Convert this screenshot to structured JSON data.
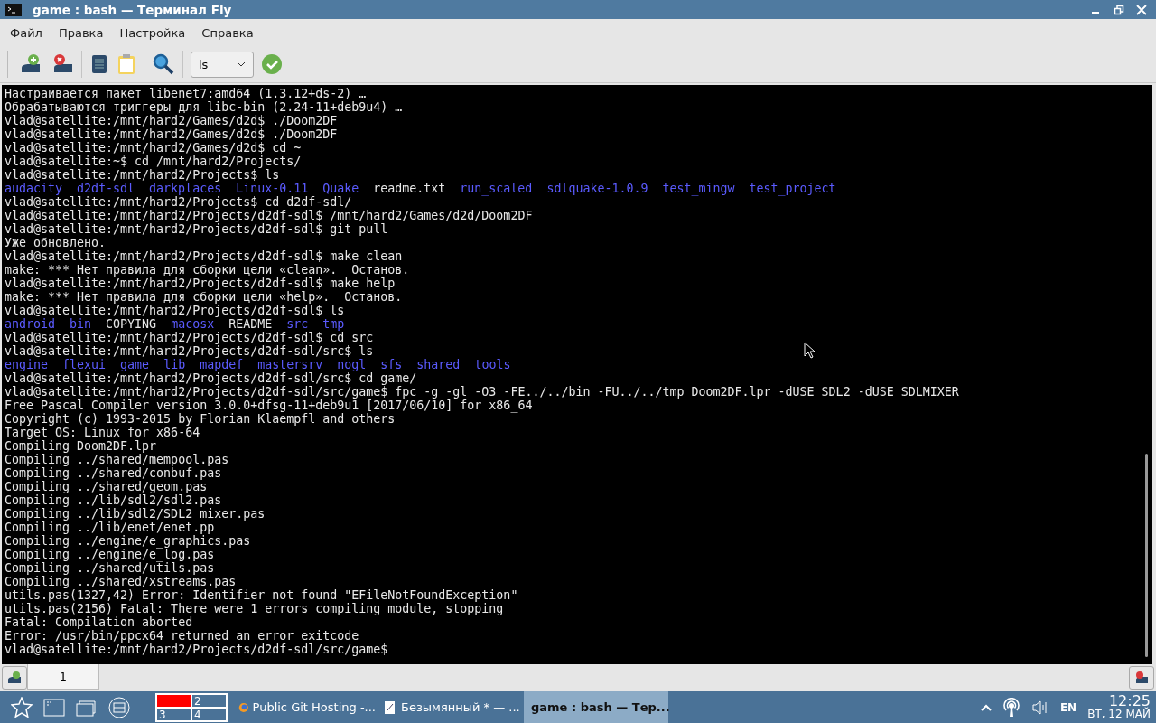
{
  "window": {
    "title": "game : bash — Терминал Fly"
  },
  "menu": [
    "Файл",
    "Правка",
    "Настройка",
    "Справка"
  ],
  "toolbar": {
    "command": {
      "value": "ls"
    }
  },
  "terminal": {
    "lines": [
      {
        "text": "Настраивается пакет libenet7:amd64 (1.3.12+ds-2) …"
      },
      {
        "text": "Обрабатываются триггеры для libc-bin (2.24-11+deb9u4) …"
      },
      {
        "text": "vlad@satellite:/mnt/hard2/Games/d2d$ ./Doom2DF"
      },
      {
        "text": "vlad@satellite:/mnt/hard2/Games/d2d$ ./Doom2DF"
      },
      {
        "text": "vlad@satellite:/mnt/hard2/Games/d2d$ cd ~"
      },
      {
        "text": "vlad@satellite:~$ cd /mnt/hard2/Projects/"
      },
      {
        "text": "vlad@satellite:/mnt/hard2/Projects$ ls"
      },
      {
        "items": [
          {
            "name": "audacity",
            "kind": "dir"
          },
          {
            "name": "d2df-sdl",
            "kind": "dir"
          },
          {
            "name": "darkplaces",
            "kind": "dir"
          },
          {
            "name": "Linux-0.11",
            "kind": "dir"
          },
          {
            "name": "Quake",
            "kind": "dir"
          },
          {
            "name": "readme.txt",
            "kind": "file"
          },
          {
            "name": "run_scaled",
            "kind": "dir"
          },
          {
            "name": "sdlquake-1.0.9",
            "kind": "dir"
          },
          {
            "name": "test_mingw",
            "kind": "dir"
          },
          {
            "name": "test_project",
            "kind": "dir"
          }
        ]
      },
      {
        "text": "vlad@satellite:/mnt/hard2/Projects$ cd d2df-sdl/"
      },
      {
        "text": "vlad@satellite:/mnt/hard2/Projects/d2df-sdl$ /mnt/hard2/Games/d2d/Doom2DF"
      },
      {
        "text": "vlad@satellite:/mnt/hard2/Projects/d2df-sdl$ git pull"
      },
      {
        "text": "Уже обновлено."
      },
      {
        "text": "vlad@satellite:/mnt/hard2/Projects/d2df-sdl$ make clean"
      },
      {
        "text": "make: *** Нет правила для сборки цели «clean».  Останов."
      },
      {
        "text": "vlad@satellite:/mnt/hard2/Projects/d2df-sdl$ make help"
      },
      {
        "text": "make: *** Нет правила для сборки цели «help».  Останов."
      },
      {
        "text": "vlad@satellite:/mnt/hard2/Projects/d2df-sdl$ ls"
      },
      {
        "items": [
          {
            "name": "android",
            "kind": "dir"
          },
          {
            "name": "bin",
            "kind": "dir"
          },
          {
            "name": "COPYING",
            "kind": "file"
          },
          {
            "name": "macosx",
            "kind": "dir"
          },
          {
            "name": "README",
            "kind": "file"
          },
          {
            "name": "src",
            "kind": "dir"
          },
          {
            "name": "tmp",
            "kind": "dir"
          }
        ]
      },
      {
        "text": "vlad@satellite:/mnt/hard2/Projects/d2df-sdl$ cd src"
      },
      {
        "text": "vlad@satellite:/mnt/hard2/Projects/d2df-sdl/src$ ls"
      },
      {
        "items": [
          {
            "name": "engine",
            "kind": "dir"
          },
          {
            "name": "flexui",
            "kind": "dir"
          },
          {
            "name": "game",
            "kind": "dir"
          },
          {
            "name": "lib",
            "kind": "dir"
          },
          {
            "name": "mapdef",
            "kind": "dir"
          },
          {
            "name": "mastersrv",
            "kind": "dir"
          },
          {
            "name": "nogl",
            "kind": "dir"
          },
          {
            "name": "sfs",
            "kind": "dir"
          },
          {
            "name": "shared",
            "kind": "dir"
          },
          {
            "name": "tools",
            "kind": "dir"
          }
        ]
      },
      {
        "text": "vlad@satellite:/mnt/hard2/Projects/d2df-sdl/src$ cd game/"
      },
      {
        "text": "vlad@satellite:/mnt/hard2/Projects/d2df-sdl/src/game$ fpc -g -gl -O3 -FE../../bin -FU../../tmp Doom2DF.lpr -dUSE_SDL2 -dUSE_SDLMIXER"
      },
      {
        "text": "Free Pascal Compiler version 3.0.0+dfsg-11+deb9u1 [2017/06/10] for x86_64"
      },
      {
        "text": "Copyright (c) 1993-2015 by Florian Klaempfl and others"
      },
      {
        "text": "Target OS: Linux for x86-64"
      },
      {
        "text": "Compiling Doom2DF.lpr"
      },
      {
        "text": "Compiling ../shared/mempool.pas"
      },
      {
        "text": "Compiling ../shared/conbuf.pas"
      },
      {
        "text": "Compiling ../shared/geom.pas"
      },
      {
        "text": "Compiling ../lib/sdl2/sdl2.pas"
      },
      {
        "text": "Compiling ../lib/sdl2/SDL2_mixer.pas"
      },
      {
        "text": "Compiling ../lib/enet/enet.pp"
      },
      {
        "text": "Compiling ../engine/e_graphics.pas"
      },
      {
        "text": "Compiling ../engine/e_log.pas"
      },
      {
        "text": "Compiling ../shared/utils.pas"
      },
      {
        "text": "Compiling ../shared/xstreams.pas"
      },
      {
        "text": "utils.pas(1327,42) Error: Identifier not found \"EFileNotFoundException\""
      },
      {
        "text": "utils.pas(2156) Fatal: There were 1 errors compiling module, stopping"
      },
      {
        "text": "Fatal: Compilation aborted"
      },
      {
        "text": "Error: /usr/bin/ppcx64 returned an error exitcode"
      },
      {
        "text": "vlad@satellite:/mnt/hard2/Projects/d2df-sdl/src/game$"
      }
    ]
  },
  "tabs": [
    {
      "label": "1",
      "selected": true
    }
  ],
  "taskbar": {
    "pager": [
      {
        "selected": true
      },
      {
        "label": "2",
        "selected": false
      },
      {
        "label": "3",
        "selected": false
      },
      {
        "label": "4",
        "selected": false
      }
    ],
    "tasks": [
      {
        "label": "Public Git Hosting -...",
        "kind": "browser",
        "selected": false
      },
      {
        "label": "Безымянный * — ...",
        "kind": "editor",
        "selected": false
      },
      {
        "label": "game : bash — Тер...",
        "kind": "terminal",
        "selected": true
      }
    ],
    "layout": "EN",
    "time": "12:25",
    "date": "ВТ, 12 МАЙ"
  }
}
